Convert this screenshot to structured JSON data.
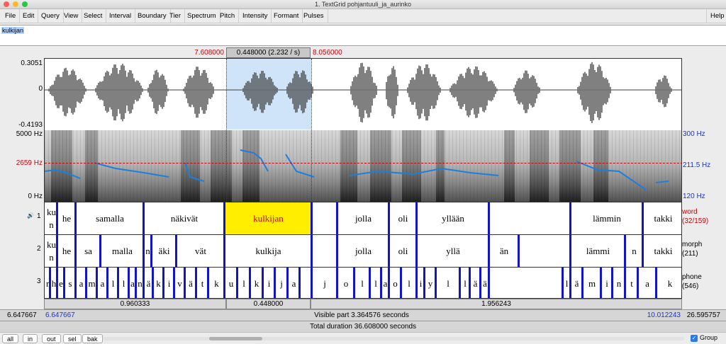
{
  "window": {
    "title": "1. TextGrid pohjantuuli_ja_aurinko"
  },
  "menu": [
    "File",
    "Edit",
    "Query",
    "View",
    "Select",
    "Interval",
    "Boundary",
    "Tier",
    "Spectrum",
    "Pitch",
    "Intensity",
    "Formant",
    "Pulses"
  ],
  "help": "Help",
  "text_field": {
    "value": "kulkijan"
  },
  "selection": {
    "start": "7.608000",
    "end": "8.056000",
    "length": "0.448000 (2.232 / s)"
  },
  "wave_axis": {
    "top": "0.3051",
    "mid": "0",
    "bottom": "-0.4193"
  },
  "spec_axis": {
    "top": "5000 Hz",
    "mid": "2659 Hz",
    "bottom": "0 Hz"
  },
  "pitch_axis": {
    "top": "300 Hz",
    "mid": "211.5 Hz",
    "bottom": "120 Hz"
  },
  "tiers": {
    "word": {
      "number": "1",
      "name": "word",
      "count": "(32/159)",
      "marker": "🔊",
      "intervals": [
        "ku n",
        "he",
        "samalla",
        "näkivät",
        "kulkijan",
        "",
        "jolla",
        "oli",
        "yllään",
        "",
        "lämmin",
        "takki"
      ]
    },
    "morph": {
      "number": "2",
      "name": "morph",
      "count": "(211)",
      "intervals": [
        "ku n",
        "he",
        "sa",
        "malla",
        "n",
        "äki",
        "vät",
        "kulkija",
        "",
        "jolla",
        "oli",
        "yllä",
        "än",
        "",
        "lämmi",
        "n",
        "takki"
      ]
    },
    "phone": {
      "number": "3",
      "name": "phone",
      "count": "(546)",
      "intervals": [
        "n",
        "h",
        "e",
        "s",
        "a",
        "m",
        "a",
        "l",
        "l",
        "a",
        "n",
        "ä",
        "k",
        "i",
        "v",
        "ä",
        "t",
        "k",
        "u",
        "l",
        "k",
        "i",
        "j",
        "a",
        "",
        "j",
        "o",
        "l",
        "l",
        "a",
        "o",
        "l",
        "i",
        "y",
        "l",
        "l",
        "ä",
        "ä",
        "",
        "l",
        "ä",
        "m",
        "i",
        "n",
        "t",
        "a",
        "k"
      ]
    }
  },
  "durations": {
    "left": "0.960333",
    "selected": "0.448000",
    "right": "1.956243"
  },
  "visible": {
    "outer_left": "6.647667",
    "inner_left": "6.647667",
    "text": "Visible part 3.364576 seconds",
    "inner_right": "10.012243",
    "outer_right": "26.595757"
  },
  "total": "Total duration 36.608000 seconds",
  "bottom": {
    "buttons": [
      "all",
      "in",
      "out",
      "sel",
      "bak"
    ],
    "group_label": "Group",
    "group_checked": true
  },
  "colors": {
    "boundary": "#1313c8",
    "selection_fill": "#ffee00",
    "selection_text": "#d0000b",
    "pitch": "#1b7fe0",
    "cursor": "#d0000b"
  }
}
